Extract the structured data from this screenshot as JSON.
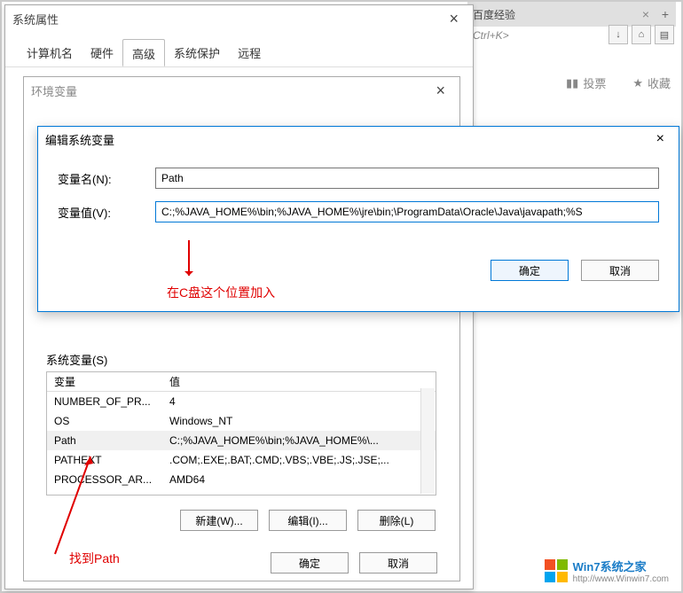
{
  "browser": {
    "tab_title": "百度经验",
    "urlbar": "Ctrl+K>",
    "vote": "投票",
    "fav": "收藏"
  },
  "sysprops": {
    "title": "系统属性",
    "tabs": {
      "computer": "计算机名",
      "hardware": "硬件",
      "advanced": "高级",
      "protection": "系统保护",
      "remote": "远程"
    }
  },
  "envvars": {
    "title": "环境变量",
    "system_vars_label": "系统变量(S)",
    "table": {
      "h_var": "变量",
      "h_val": "值",
      "rows": [
        {
          "var": "NUMBER_OF_PR...",
          "val": "4"
        },
        {
          "var": "OS",
          "val": "Windows_NT"
        },
        {
          "var": "Path",
          "val": "C:;%JAVA_HOME%\\bin;%JAVA_HOME%\\..."
        },
        {
          "var": "PATHEXT",
          "val": ".COM;.EXE;.BAT;.CMD;.VBS;.VBE;.JS;.JSE;..."
        },
        {
          "var": "PROCESSOR_AR...",
          "val": "AMD64"
        }
      ]
    },
    "btn_new": "新建(W)...",
    "btn_edit": "编辑(I)...",
    "btn_del": "删除(L)",
    "btn_ok": "确定",
    "btn_cancel": "取消"
  },
  "editdlg": {
    "title": "编辑系统变量",
    "name_label": "变量名(N):",
    "name_value": "Path",
    "value_label": "变量值(V):",
    "value_value": "C:;%JAVA_HOME%\\bin;%JAVA_HOME%\\jre\\bin;\\ProgramData\\Oracle\\Java\\javapath;%S",
    "ok": "确定",
    "cancel": "取消"
  },
  "annotations": {
    "insert_hint": "在C盘这个位置加入",
    "find_path": "找到Path"
  },
  "watermark": {
    "brand": "Win7系统之家",
    "url": "http://www.Winwin7.com"
  }
}
